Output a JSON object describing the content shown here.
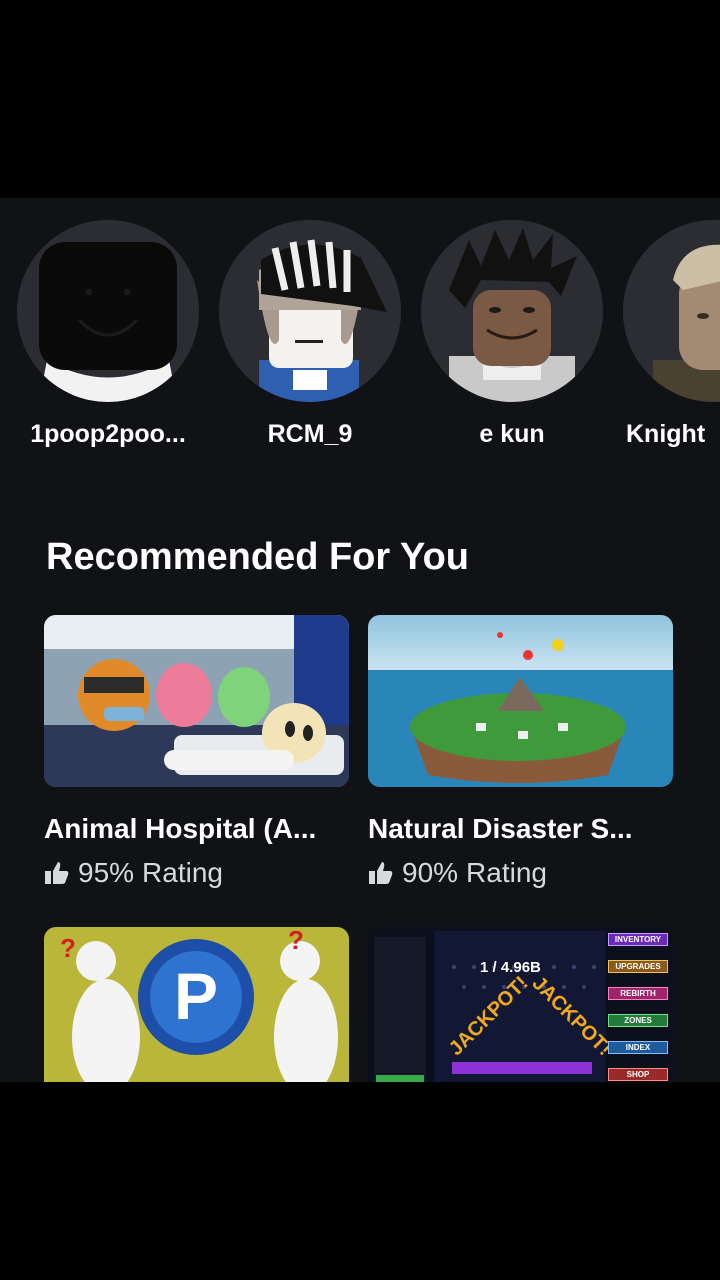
{
  "friends": [
    {
      "name": "1poop2poo..."
    },
    {
      "name": "RCM_9"
    },
    {
      "name": "e kun"
    },
    {
      "name": "Knight"
    }
  ],
  "section": {
    "title": "Recommended For You"
  },
  "games": [
    {
      "title": "Animal Hospital (A...",
      "rating_pct": "95%",
      "rating_label": "Rating"
    },
    {
      "title": "Natural Disaster S...",
      "rating_pct": "90%",
      "rating_label": "Rating"
    }
  ],
  "game3_menu": [
    "INVENTORY",
    "UPGRADES",
    "REBIRTH",
    "ZONES",
    "INDEX",
    "SHOP"
  ],
  "game3_counter": "1 / 4.96B",
  "game3_banner": "JACKPOT!",
  "icons": {
    "rating": "thumbs-up-icon"
  }
}
